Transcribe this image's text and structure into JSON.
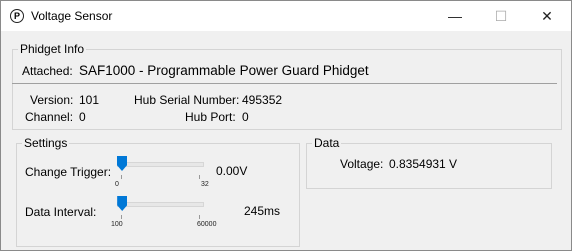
{
  "window": {
    "title": "Voltage Sensor",
    "icon": "phidget-logo-icon",
    "controls": {
      "minimize": "—",
      "maximize": "☐",
      "close": "✕"
    }
  },
  "phidget_info": {
    "legend": "Phidget Info",
    "attached_label": "Attached:",
    "attached_value": "SAF1000 - Programmable Power Guard Phidget",
    "version_label": "Version:",
    "version_value": "101",
    "hub_serial_label": "Hub Serial Number:",
    "hub_serial_value": "495352",
    "channel_label": "Channel:",
    "channel_value": "0",
    "hub_port_label": "Hub Port:",
    "hub_port_value": "0"
  },
  "settings": {
    "legend": "Settings",
    "change_trigger": {
      "label": "Change Trigger:",
      "value": "0.00V",
      "min_label": "0",
      "max_label": "32",
      "position": 0
    },
    "data_interval": {
      "label": "Data Interval:",
      "value": "245ms",
      "min_label": "100",
      "max_label": "60000",
      "position": 0.0024
    }
  },
  "data": {
    "legend": "Data",
    "voltage_label": "Voltage:",
    "voltage_value": "0.8354931 V"
  },
  "colors": {
    "accent": "#0078d7",
    "background": "#f0f0f0",
    "titlebar": "#ffffff"
  }
}
